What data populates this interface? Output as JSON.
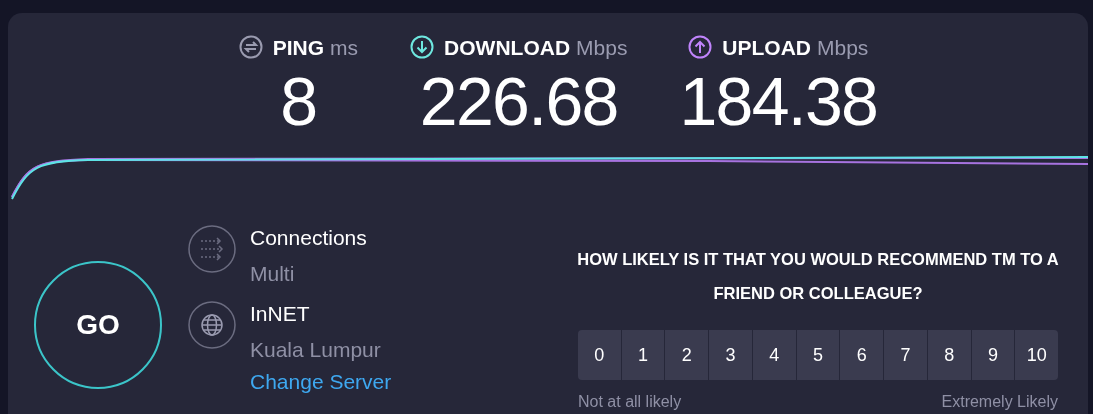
{
  "metrics": [
    {
      "kind": "ping",
      "label": "PING",
      "unit": "ms",
      "value": "8"
    },
    {
      "kind": "download",
      "label": "DOWNLOAD",
      "unit": "Mbps",
      "value": "226.68"
    },
    {
      "kind": "upload",
      "label": "UPLOAD",
      "unit": "Mbps",
      "value": "184.38"
    }
  ],
  "go_button": "GO",
  "connections": {
    "label": "Connections",
    "value": "Multi"
  },
  "server": {
    "name": "InNET",
    "location": "Kuala Lumpur",
    "link": "Change Server"
  },
  "survey": {
    "question": "HOW LIKELY IS IT THAT YOU WOULD RECOMMEND TM TO A FRIEND OR COLLEAGUE?",
    "options": [
      "0",
      "1",
      "2",
      "3",
      "4",
      "5",
      "6",
      "7",
      "8",
      "9",
      "10"
    ],
    "low_label": "Not at all likely",
    "high_label": "Extremely Likely"
  }
}
